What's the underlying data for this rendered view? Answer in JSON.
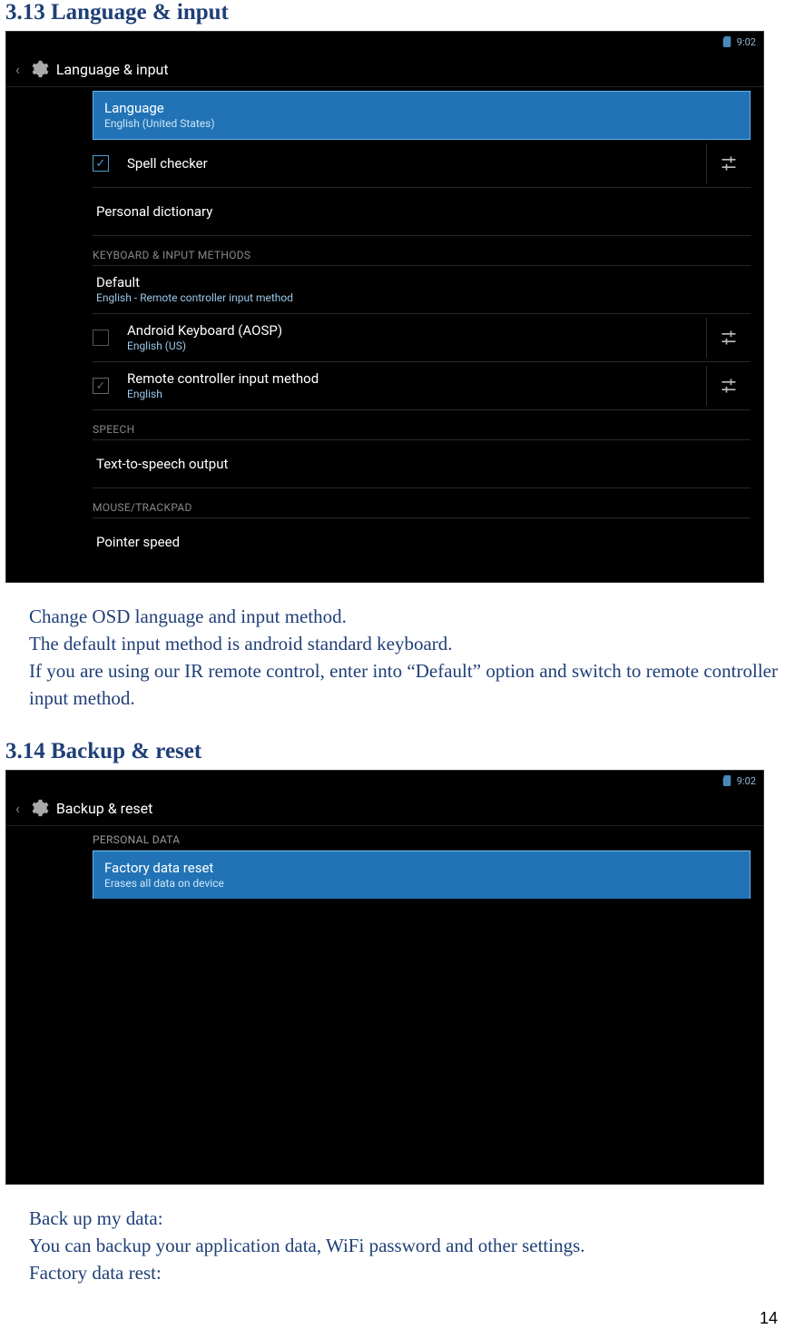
{
  "page_number": "14",
  "section1": {
    "heading": "3.13 Language & input",
    "status_time": "9:02",
    "title": "Language & input",
    "rows": {
      "language": {
        "title": "Language",
        "sub": "English (United States)"
      },
      "spell": {
        "title": "Spell checker"
      },
      "dict": {
        "title": "Personal dictionary"
      },
      "cat_keyboard": "KEYBOARD & INPUT METHODS",
      "default": {
        "title": "Default",
        "sub": "English - Remote controller input method"
      },
      "aosp": {
        "title": "Android Keyboard (AOSP)",
        "sub": "English (US)"
      },
      "remote": {
        "title": "Remote controller input method",
        "sub": "English"
      },
      "cat_speech": "SPEECH",
      "tts": {
        "title": "Text-to-speech output"
      },
      "cat_mouse": "MOUSE/TRACKPAD",
      "pointer": {
        "title": "Pointer speed"
      }
    },
    "body": {
      "p1": "Change OSD language and input method.",
      "p2": "The default input method is android standard keyboard.",
      "p3": "If you are using our IR remote control, enter into “Default” option and switch to remote controller input method."
    }
  },
  "section2": {
    "heading": "3.14 Backup & reset",
    "status_time": "9:02",
    "title": "Backup & reset",
    "cat_personal": "PERSONAL DATA",
    "row": {
      "title": "Factory data reset",
      "sub": "Erases all data on device"
    },
    "body": {
      "p1": "Back up my data:",
      "p2": "You can backup your application data, WiFi password and other settings.",
      "p3": "Factory data rest:"
    }
  }
}
